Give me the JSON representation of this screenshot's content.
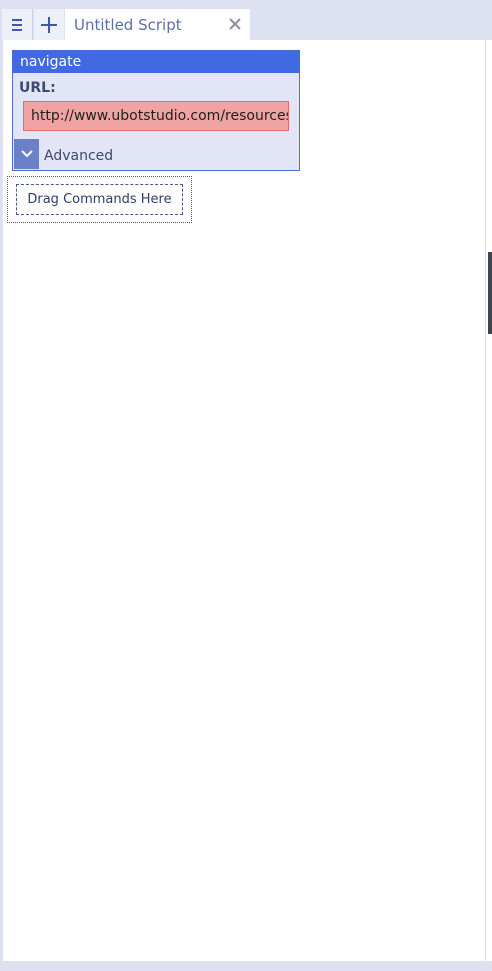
{
  "tabbar": {
    "menu_icon": "hamburger-icon",
    "add_icon": "plus-icon",
    "tab_title": "Untitled Script",
    "close_icon": "close-icon"
  },
  "command": {
    "name": "navigate",
    "field_label": "URL:",
    "url_value": "http://www.ubotstudio.com/resources",
    "advanced_icon": "chevron-down-icon",
    "advanced_label": "Advanced"
  },
  "dropzone": {
    "label": "Drag Commands Here"
  },
  "colors": {
    "accent": "#4169e1",
    "invalid_field": "#f0a3a3",
    "chrome": "#dde1f2"
  }
}
